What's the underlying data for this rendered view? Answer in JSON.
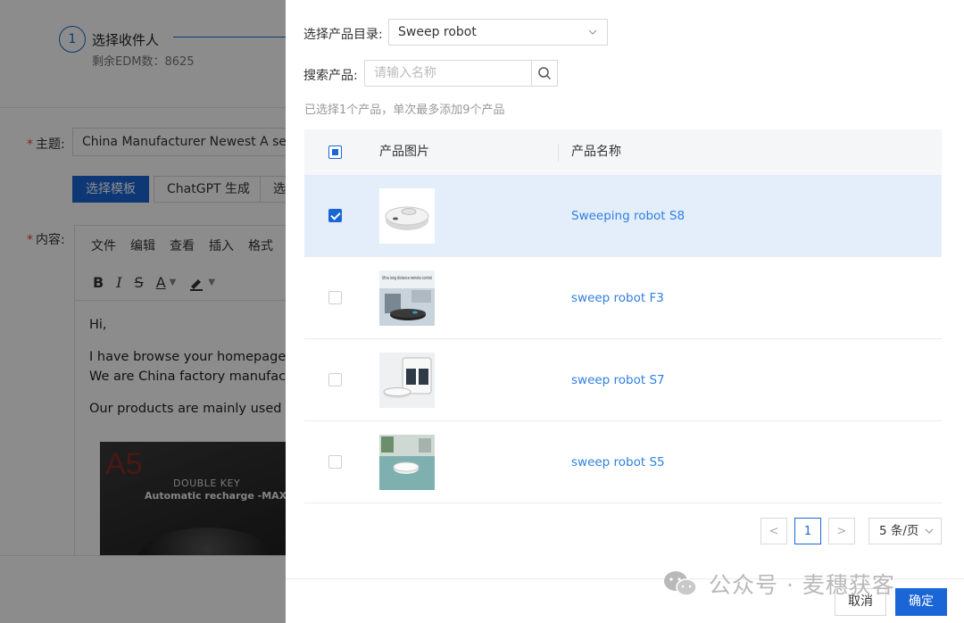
{
  "background": {
    "step": {
      "number": "1",
      "title": "选择收件人",
      "subtitle": "剩余EDM数：8625"
    },
    "subject": {
      "label": "主题:",
      "value": "China Manufacturer Newest A series Ro"
    },
    "buttons": {
      "select_template": "选择模板",
      "chatgpt": "ChatGPT 生成",
      "more": "选"
    },
    "content_label": "内容:",
    "editor": {
      "menu": [
        "文件",
        "编辑",
        "查看",
        "插入",
        "格式"
      ],
      "toolbar": {
        "bold": "B",
        "italic": "I",
        "strike": "S",
        "font_color": "A"
      },
      "body": {
        "greeting": "Hi,",
        "line1": "I have browse your homepage,  s",
        "line2": "We are China factory manufactur",
        "line3": "Our products are mainly used fo"
      },
      "image": {
        "big_text": "A5",
        "line1": "DOUBLE KEY",
        "line2": "Automatic recharge -MAX"
      }
    }
  },
  "drawer": {
    "catalog": {
      "label": "选择产品目录:",
      "value": "Sweep robot"
    },
    "search": {
      "label": "搜索产品:",
      "placeholder": "请输入名称"
    },
    "hint": "已选择1个产品，单次最多添加9个产品",
    "table": {
      "columns": {
        "image": "产品图片",
        "name": "产品名称"
      },
      "rows": [
        {
          "name": "Sweeping robot S8",
          "selected": true,
          "thumb_caption": ""
        },
        {
          "name": "sweep robot F3",
          "selected": false,
          "thumb_caption": "Ultra long distance remote control"
        },
        {
          "name": "sweep robot S7",
          "selected": false,
          "thumb_caption": ""
        },
        {
          "name": "sweep robot S5",
          "selected": false,
          "thumb_caption": ""
        }
      ]
    },
    "pagination": {
      "prev": "<",
      "current": "1",
      "next": ">",
      "page_size": "5 条/页"
    },
    "footer": {
      "cancel": "取消",
      "confirm": "确定"
    }
  },
  "watermark": {
    "text": "公众号 · 麦穗获客"
  },
  "colors": {
    "primary": "#1a66d6",
    "link": "#2f7fe0",
    "selected_row": "#e4eefb",
    "overlay": "rgba(0,0,0,0.45)"
  }
}
